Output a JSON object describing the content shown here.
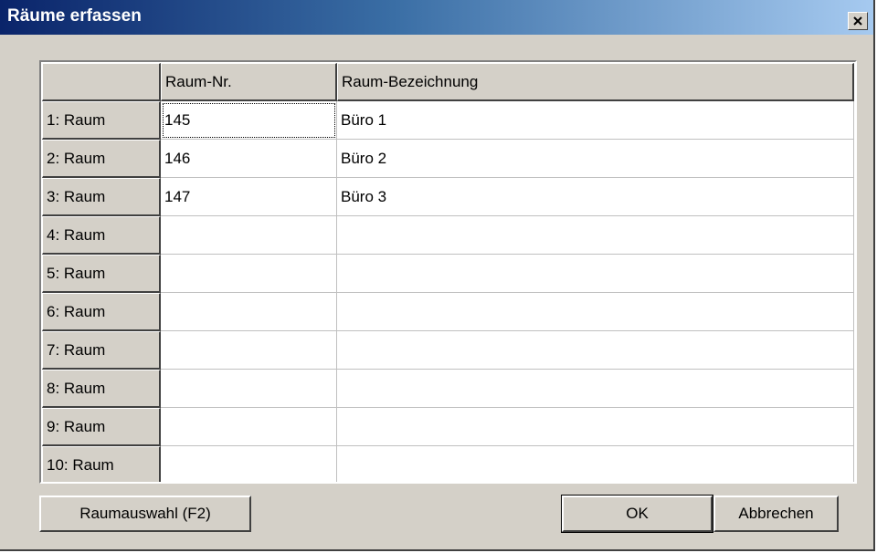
{
  "window": {
    "title": "Räume erfassen",
    "close_symbol": "×"
  },
  "grid": {
    "columns": [
      "",
      "Raum-Nr.",
      "Raum-Bezeichnung"
    ],
    "rows": [
      {
        "header": "1: Raum",
        "nr": "145",
        "name": "Büro 1"
      },
      {
        "header": "2: Raum",
        "nr": "146",
        "name": "Büro 2"
      },
      {
        "header": "3: Raum",
        "nr": "147",
        "name": "Büro 3"
      },
      {
        "header": "4: Raum",
        "nr": "",
        "name": ""
      },
      {
        "header": "5: Raum",
        "nr": "",
        "name": ""
      },
      {
        "header": "6: Raum",
        "nr": "",
        "name": ""
      },
      {
        "header": "7: Raum",
        "nr": "",
        "name": ""
      },
      {
        "header": "8: Raum",
        "nr": "",
        "name": ""
      },
      {
        "header": "9: Raum",
        "nr": "",
        "name": ""
      },
      {
        "header": "10: Raum",
        "nr": "",
        "name": ""
      }
    ]
  },
  "buttons": {
    "raumauswahl": "Raumauswahl (F2)",
    "ok": "OK",
    "abbrechen": "Abbrechen"
  },
  "icons": {
    "close": "close-icon"
  }
}
